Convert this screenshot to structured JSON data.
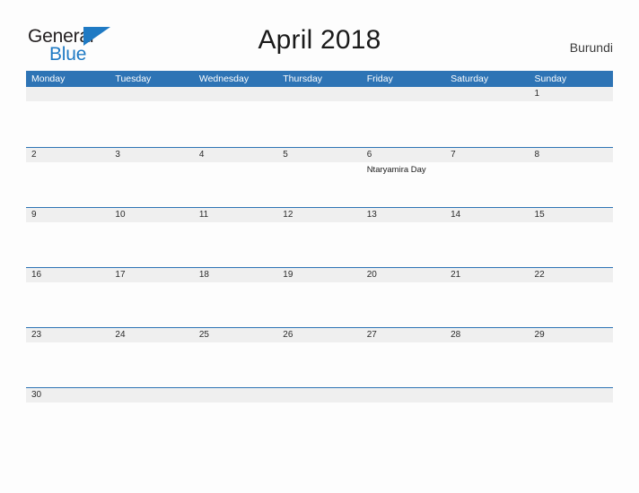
{
  "logo": {
    "word_one": "General",
    "word_two": "Blue",
    "triangle_color": "#1f7ac4",
    "icon": "triangle-flag-icon"
  },
  "header": {
    "title": "April 2018",
    "country": "Burundi"
  },
  "colors": {
    "header_blue": "#2e74b5",
    "day_band_gray": "#efefef",
    "page_background": "#fdfdfd",
    "text_dark": "#1a1a1a",
    "logo_blue": "#1f7ac4"
  },
  "calendar": {
    "month": "April",
    "year": "2018",
    "weekdays": [
      "Monday",
      "Tuesday",
      "Wednesday",
      "Thursday",
      "Friday",
      "Saturday",
      "Sunday"
    ],
    "weeks": [
      {
        "days": [
          {
            "num": "",
            "event": ""
          },
          {
            "num": "",
            "event": ""
          },
          {
            "num": "",
            "event": ""
          },
          {
            "num": "",
            "event": ""
          },
          {
            "num": "",
            "event": ""
          },
          {
            "num": "",
            "event": ""
          },
          {
            "num": "1",
            "event": ""
          }
        ]
      },
      {
        "days": [
          {
            "num": "2",
            "event": ""
          },
          {
            "num": "3",
            "event": ""
          },
          {
            "num": "4",
            "event": ""
          },
          {
            "num": "5",
            "event": ""
          },
          {
            "num": "6",
            "event": "Ntaryamira Day"
          },
          {
            "num": "7",
            "event": ""
          },
          {
            "num": "8",
            "event": ""
          }
        ]
      },
      {
        "days": [
          {
            "num": "9",
            "event": ""
          },
          {
            "num": "10",
            "event": ""
          },
          {
            "num": "11",
            "event": ""
          },
          {
            "num": "12",
            "event": ""
          },
          {
            "num": "13",
            "event": ""
          },
          {
            "num": "14",
            "event": ""
          },
          {
            "num": "15",
            "event": ""
          }
        ]
      },
      {
        "days": [
          {
            "num": "16",
            "event": ""
          },
          {
            "num": "17",
            "event": ""
          },
          {
            "num": "18",
            "event": ""
          },
          {
            "num": "19",
            "event": ""
          },
          {
            "num": "20",
            "event": ""
          },
          {
            "num": "21",
            "event": ""
          },
          {
            "num": "22",
            "event": ""
          }
        ]
      },
      {
        "days": [
          {
            "num": "23",
            "event": ""
          },
          {
            "num": "24",
            "event": ""
          },
          {
            "num": "25",
            "event": ""
          },
          {
            "num": "26",
            "event": ""
          },
          {
            "num": "27",
            "event": ""
          },
          {
            "num": "28",
            "event": ""
          },
          {
            "num": "29",
            "event": ""
          }
        ]
      },
      {
        "days": [
          {
            "num": "30",
            "event": ""
          },
          {
            "num": "",
            "event": ""
          },
          {
            "num": "",
            "event": ""
          },
          {
            "num": "",
            "event": ""
          },
          {
            "num": "",
            "event": ""
          },
          {
            "num": "",
            "event": ""
          },
          {
            "num": "",
            "event": ""
          }
        ]
      }
    ]
  }
}
